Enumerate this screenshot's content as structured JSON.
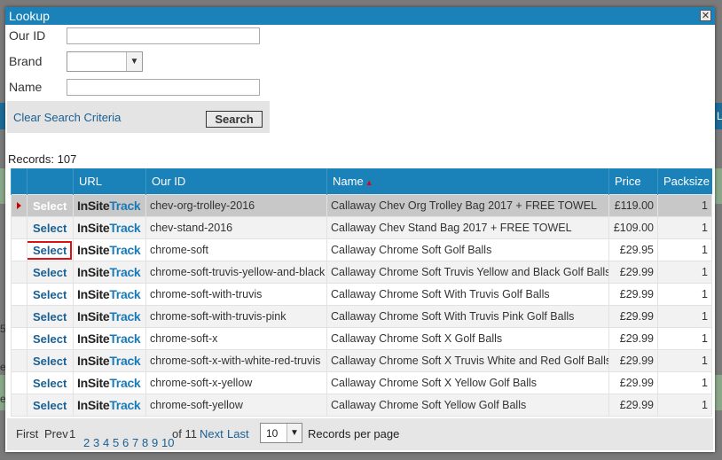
{
  "dialog": {
    "title": "Lookup",
    "close_icon": "close-icon",
    "close_glyph": "✕"
  },
  "form": {
    "our_id_label": "Our ID",
    "our_id_value": "",
    "brand_label": "Brand",
    "brand_value": "",
    "name_label": "Name",
    "name_value": "",
    "clear_label": "Clear Search Criteria",
    "search_label": "Search"
  },
  "records": {
    "label": "Records:",
    "count": "107"
  },
  "table": {
    "columns": {
      "url": "URL",
      "our_id": "Our ID",
      "name": "Name",
      "price": "Price",
      "packsize": "Packsize"
    },
    "sort_column": "Name",
    "sort_glyph": "▲",
    "select_label": "Select",
    "logo_a": "InSite",
    "logo_b": "Track",
    "rows": [
      {
        "id": "chev-org-trolley-2016",
        "name": "Callaway Chev Org Trolley Bag 2017 + FREE TOWEL",
        "price": "£119.00",
        "pack": "1",
        "selected": true
      },
      {
        "id": "chev-stand-2016",
        "name": "Callaway Chev Stand Bag 2017 + FREE TOWEL",
        "price": "£109.00",
        "pack": "1"
      },
      {
        "id": "chrome-soft",
        "name": "Callaway Chrome Soft Golf Balls",
        "price": "£29.95",
        "pack": "1",
        "highlight": true
      },
      {
        "id": "chrome-soft-truvis-yellow-and-black",
        "name": "Callaway Chrome Soft Truvis Yellow and Black Golf Balls",
        "price": "£29.99",
        "pack": "1"
      },
      {
        "id": "chrome-soft-with-truvis",
        "name": "Callaway Chrome Soft With Truvis Golf Balls",
        "price": "£29.99",
        "pack": "1"
      },
      {
        "id": "chrome-soft-with-truvis-pink",
        "name": "Callaway Chrome Soft With Truvis Pink Golf Balls",
        "price": "£29.99",
        "pack": "1"
      },
      {
        "id": "chrome-soft-x",
        "name": "Callaway Chrome Soft X Golf Balls",
        "price": "£29.99",
        "pack": "1"
      },
      {
        "id": "chrome-soft-x-with-white-red-truvis",
        "name": "Callaway Chrome Soft X Truvis White and Red Golf Balls",
        "price": "£29.99",
        "pack": "1"
      },
      {
        "id": "chrome-soft-x-yellow",
        "name": "Callaway Chrome Soft X Yellow Golf Balls",
        "price": "£29.99",
        "pack": "1"
      },
      {
        "id": "chrome-soft-yellow",
        "name": "Callaway Chrome Soft Yellow Golf Balls",
        "price": "£29.99",
        "pack": "1"
      }
    ]
  },
  "pager": {
    "first": "First",
    "prev": "Prev",
    "current": "1",
    "pages": [
      "2",
      "3",
      "4",
      "5",
      "6",
      "7",
      "8",
      "9",
      "10"
    ],
    "of_label": "of 11",
    "next": "Next",
    "last": "Last",
    "per_page_value": "10",
    "per_page_label": "Records per page"
  },
  "background": {
    "fragments": [
      "L",
      "5",
      "el",
      "el"
    ]
  },
  "colors": {
    "header": "#1a82b8",
    "link": "#1a5f92",
    "highlight": "#d11111",
    "indicator": "#cc0000"
  }
}
